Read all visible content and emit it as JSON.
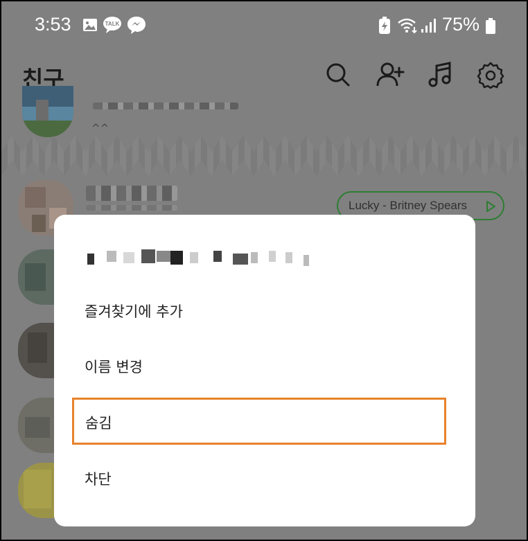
{
  "status_bar": {
    "time": "3:53",
    "battery": "75%",
    "left_icons": [
      "image-icon",
      "kakaotalk-talk-icon",
      "messenger-icon"
    ],
    "right_icons": [
      "battery-saver-icon",
      "wifi-icon",
      "signal-icon",
      "battery-icon"
    ],
    "talk_badge": "TALK"
  },
  "header": {
    "title": "친구",
    "icons": [
      "search-icon",
      "add-friend-icon",
      "music-icon",
      "settings-icon"
    ]
  },
  "friend_list": {
    "first_item_status": "^^",
    "music_pill": "Lucky - Britney Spears"
  },
  "context_menu": {
    "items": [
      {
        "label": "즐겨찾기에 추가"
      },
      {
        "label": "이름 변경"
      },
      {
        "label": "숨김",
        "highlighted": true
      },
      {
        "label": "차단"
      }
    ]
  },
  "colors": {
    "overlay": "#808080",
    "accent_green": "#2e7d32",
    "highlight": "#e8822a",
    "highlight_fill": "#f8c98a"
  }
}
